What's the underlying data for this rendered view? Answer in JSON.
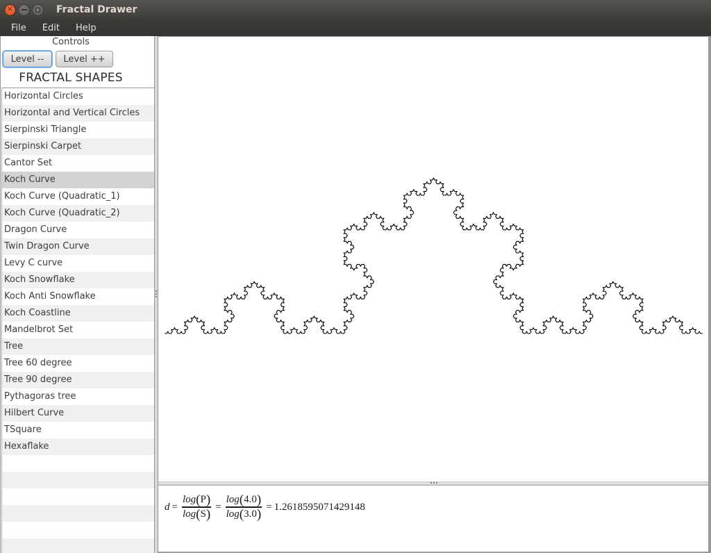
{
  "window": {
    "title": "Fractal Drawer",
    "buttons": [
      "close-icon",
      "minimize-icon",
      "maximize-icon"
    ]
  },
  "menu": {
    "items": [
      {
        "label": "File"
      },
      {
        "label": "Edit"
      },
      {
        "label": "Help"
      }
    ]
  },
  "controls": {
    "label": "Controls",
    "level_dec_label": "Level --",
    "level_inc_label": "Level ++",
    "shapes_heading": "FRACTAL SHAPES"
  },
  "shapes": {
    "selected": "Koch Curve",
    "items": [
      "Horizontal Circles",
      "Horizontal and Vertical Circles",
      "Sierpinski Triangle",
      "Sierpinski Carpet",
      "Cantor Set",
      "Koch Curve",
      "Koch Curve (Quadratic_1)",
      "Koch Curve (Quadratic_2)",
      "Dragon Curve",
      "Twin Dragon Curve",
      "Levy C curve",
      "Koch Snowflake",
      "Koch Anti Snowflake",
      "Koch Coastline",
      "Mandelbrot Set",
      "Tree",
      "Tree 60 degree",
      "Tree 90 degree",
      "Pythagoras tree",
      "Hilbert Curve",
      "TSquare",
      "Hexaflake"
    ]
  },
  "drawing": {
    "fractal": "Koch Curve",
    "level": 5,
    "stroke_color": "#000000"
  },
  "formula": {
    "lhs": "d",
    "eq": "=",
    "num_symbol": "P",
    "den_symbol": "S",
    "log": "log",
    "num_value": "4.0",
    "den_value": "3.0",
    "result": "1.2618595071429148"
  }
}
